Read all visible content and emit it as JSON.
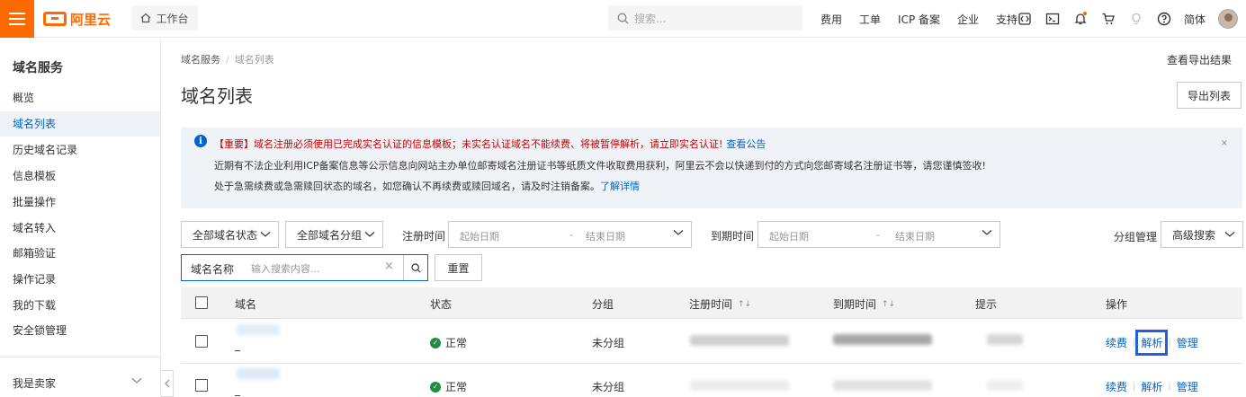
{
  "topbar": {
    "logo_text": "阿里云",
    "workbench": "工作台",
    "search_placeholder": "搜索...",
    "links": [
      "费用",
      "工单",
      "ICP 备案",
      "企业",
      "支持"
    ],
    "lang": "简体",
    "icons": [
      "terminal-code-icon",
      "console-icon",
      "bell-icon",
      "cart-icon",
      "lightbulb-icon",
      "help-icon"
    ]
  },
  "sidebar": {
    "title": "域名服务",
    "items": [
      "概览",
      "域名列表",
      "历史域名记录",
      "信息模板",
      "批量操作",
      "域名转入",
      "邮箱验证",
      "操作记录",
      "我的下载",
      "安全锁管理"
    ],
    "active_index": 1,
    "seller": "我是卖家"
  },
  "breadcrumb": {
    "root": "域名服务",
    "current": "域名列表"
  },
  "page": {
    "title": "域名列表",
    "export_result": "查看导出结果",
    "export_list": "导出列表"
  },
  "notice": {
    "line1": "【重要】域名注册必须使用已完成实名认证的信息模板；未实名认证域名不能续费、将被暂停解析，请立即实名认证!",
    "line1_link": "查看公告",
    "line2": "近期有不法企业利用ICP备案信息等公示信息向网站主办单位邮寄域名注册证书等纸质文件收取费用获利，阿里云不会以快递到付的方式向您邮寄域名注册证书等，请您谨慎签收!",
    "line3": "处于急需续费或急需赎回状态的域名，如您确认不再续费或赎回域名，请及时注销备案。",
    "line3_link": "了解详情"
  },
  "filters": {
    "status_select": "全部域名状态",
    "group_select": "全部域名分组",
    "reg_label": "注册时间",
    "exp_label": "到期时间",
    "start_placeholder": "起始日期",
    "end_placeholder": "结束日期",
    "date_sep": "-",
    "group_manage": "分组管理",
    "advanced": "高级搜索",
    "query_label": "域名名称",
    "query_placeholder": "输入搜索内容...",
    "reset": "重置"
  },
  "table": {
    "headers": [
      "域名",
      "状态",
      "分组",
      "注册时间",
      "到期时间",
      "提示",
      "操作"
    ],
    "rows": [
      {
        "status": "正常",
        "group": "未分组",
        "sub": "_",
        "ops": [
          "续费",
          "解析",
          "管理"
        ]
      },
      {
        "status": "正常",
        "group": "未分组",
        "sub": "_",
        "ops": [
          "续费",
          "解析",
          "管理"
        ]
      }
    ]
  },
  "colors": {
    "brand": "#ff6a00",
    "link": "#0064c8",
    "highlight": "#1f5fe0",
    "warn": "#c80000",
    "ok": "#1e8e3e"
  }
}
